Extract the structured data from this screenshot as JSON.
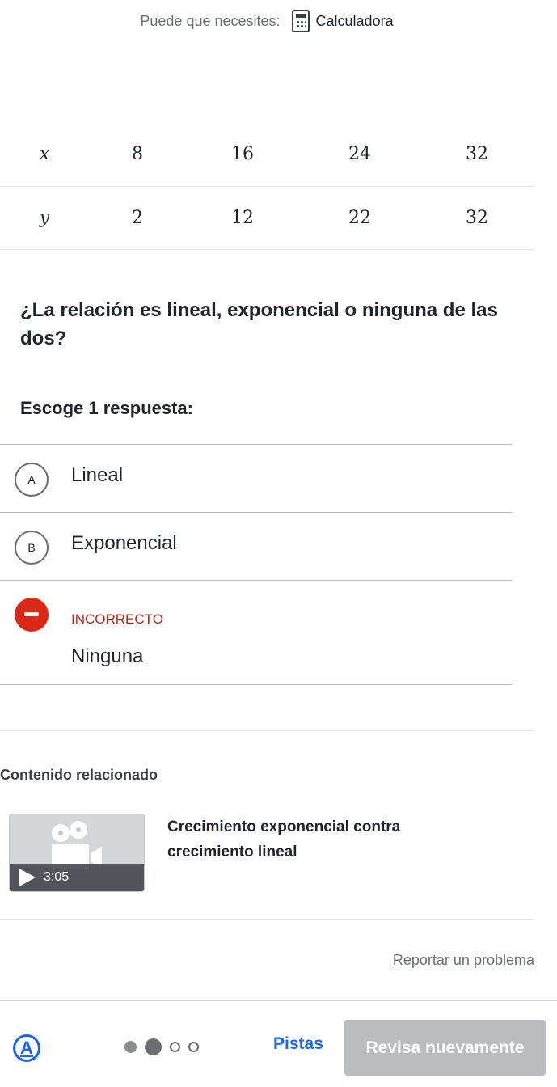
{
  "tools": {
    "prefix": "Puede que necesites:",
    "calculator_label": "Calculadora"
  },
  "table": {
    "x_label": "x",
    "y_label": "y",
    "x_values": [
      "8",
      "16",
      "24",
      "32"
    ],
    "y_values": [
      "2",
      "12",
      "22",
      "32"
    ]
  },
  "question": {
    "text": "¿La relación es lineal, exponencial o ninguna de las dos?",
    "choose_prompt": "Escoge 1 respuesta:"
  },
  "choices": [
    {
      "letter": "A",
      "label": "Lineal"
    },
    {
      "letter": "B",
      "label": "Exponencial"
    },
    {
      "status": "INCORRECTO",
      "label": "Ninguna"
    }
  ],
  "related": {
    "title": "Contenido relacionado",
    "video_duration": "3:05",
    "video_title": "Crecimiento exponencial contra crecimiento lineal"
  },
  "report_link": "Reportar un problema",
  "footer": {
    "a11y_label": "A",
    "hints_label": "Pistas",
    "check_again_label": "Revisa nuevamente"
  },
  "colors": {
    "accent": "#1865f2",
    "incorrect": "#d92916",
    "button_disabled": "#bbbcc0"
  }
}
